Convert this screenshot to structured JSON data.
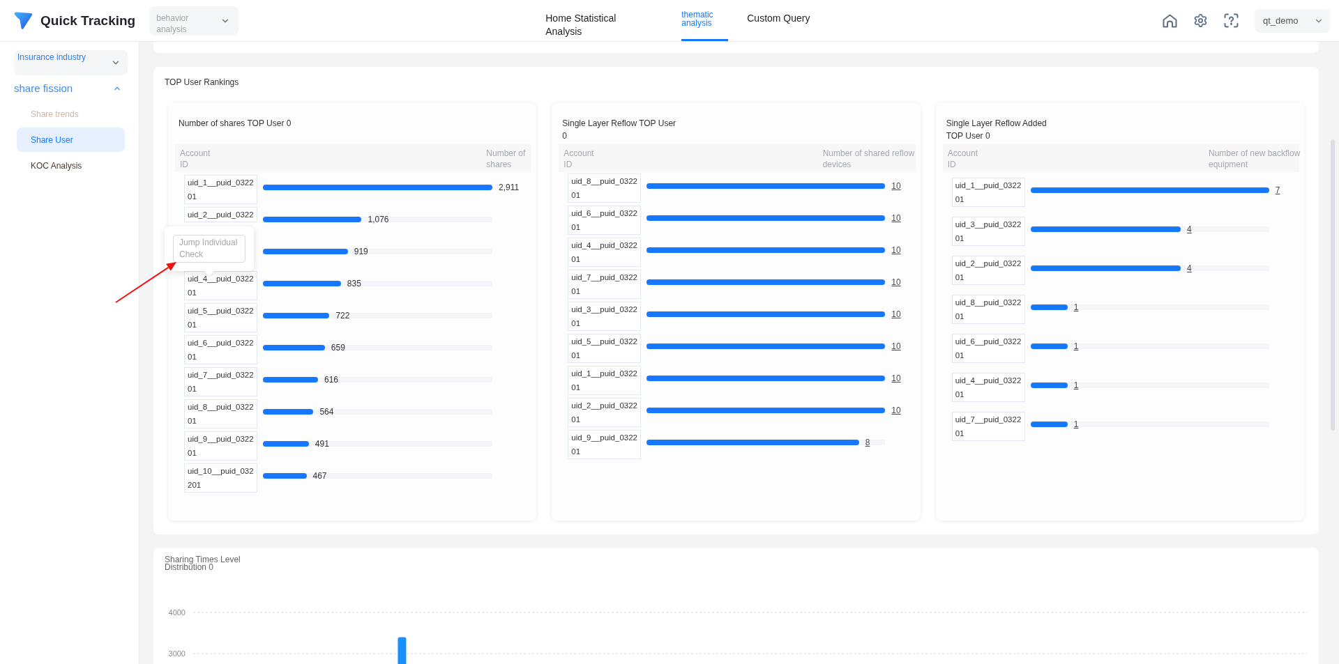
{
  "header": {
    "logo": "Quick Tracking",
    "module_select": "behavior analysis",
    "tabs": [
      {
        "label": "Home Statistical Analysis",
        "selected": false
      },
      {
        "label": "thematic analysis",
        "selected": true
      },
      {
        "label": "Custom Query",
        "selected": false
      }
    ],
    "user_select": "qt_demo"
  },
  "sidebar": {
    "industry_select": "Insurance industry",
    "groups": [
      {
        "label": "share fission",
        "expanded": true,
        "items": [
          {
            "label": "Share trends",
            "selected": false,
            "disabled": true
          },
          {
            "label": "Share User",
            "selected": true,
            "disabled": false
          },
          {
            "label": "KOC Analysis",
            "selected": false,
            "disabled": false
          }
        ]
      }
    ]
  },
  "rankings": {
    "title": "TOP User Rankings",
    "cards": [
      {
        "title": "Number of shares TOP User 0",
        "kind": "plain",
        "columns": [
          "Account ID",
          "Number of shares"
        ],
        "rows": [
          {
            "id": "uid_1__puid_032201",
            "level": 1,
            "value": "2,911"
          },
          {
            "id": "uid_2__puid_0322",
            "level": 0.43,
            "value": "1,076"
          },
          {
            "level": 0.37,
            "value": "919"
          },
          {
            "id": "uid_4__puid_032201",
            "level": 0.34,
            "value": "835",
            "tooltip": {
              "action": "Jump Individual Check"
            }
          },
          {
            "id": "uid_5__puid_032201",
            "level": 0.29,
            "value": "722"
          },
          {
            "id": "uid_6__puid_032201",
            "level": 0.27,
            "value": "659"
          },
          {
            "id": "uid_7__puid_032201",
            "level": 0.24,
            "value": "616"
          },
          {
            "id": "uid_8__puid_032201",
            "level": 0.22,
            "value": "564"
          },
          {
            "id": "uid_9__puid_032201",
            "level": 0.2,
            "value": "491"
          },
          {
            "id": "uid_10__puid_032201",
            "level": 0.19,
            "value": "467"
          }
        ]
      },
      {
        "title": "Single Layer Reflow TOP User 0",
        "kind": "linked",
        "columns": [
          "Account ID",
          "Number of shared reflow devices"
        ],
        "rows": [
          {
            "id": "uid_8__puid_032201",
            "level": 1,
            "value": "10"
          },
          {
            "id": "uid_6__puid_032201",
            "level": 1,
            "value": "10"
          },
          {
            "id": "uid_4__puid_032201",
            "level": 1,
            "value": "10"
          },
          {
            "id": "uid_7__puid_032201",
            "level": 1,
            "value": "10"
          },
          {
            "id": "uid_3__puid_032201",
            "level": 1,
            "value": "10"
          },
          {
            "id": "uid_5__puid_032201",
            "level": 1,
            "value": "10"
          },
          {
            "id": "uid_1__puid_032201",
            "level": 1,
            "value": "10"
          },
          {
            "id": "uid_2__puid_032201",
            "level": 1,
            "value": "10"
          },
          {
            "id": "uid_9__puid_032201",
            "level": 0.89,
            "value": "8"
          }
        ]
      },
      {
        "title": "Single Layer Reflow Added TOP User 0",
        "kind": "linked",
        "columns": [
          "Account ID",
          "Number of new backflow equipment"
        ],
        "rows": [
          {
            "id": "uid_1__puid_032201",
            "level": 1,
            "value": "7"
          },
          {
            "id": "uid_3__puid_032201",
            "level": 0.63,
            "value": "4"
          },
          {
            "id": "uid_2__puid_032201",
            "level": 0.63,
            "value": "4"
          },
          {
            "id": "uid_8__puid_032201",
            "level": 0.155,
            "value": "1"
          },
          {
            "id": "uid_6__puid_032201",
            "level": 0.155,
            "value": "1"
          },
          {
            "id": "uid_4__puid_032201",
            "level": 0.155,
            "value": "1"
          },
          {
            "id": "uid_7__puid_032201",
            "level": 0.155,
            "value": "1"
          }
        ]
      }
    ]
  },
  "distribution": {
    "chart_data": {
      "type": "bar",
      "title": "Sharing Times Level Distribution 0",
      "ylim": [
        2750,
        4000
      ],
      "yticks": [
        3000,
        4000
      ],
      "values": [
        null,
        3400,
        null,
        null,
        null,
        null,
        null,
        null
      ]
    }
  }
}
